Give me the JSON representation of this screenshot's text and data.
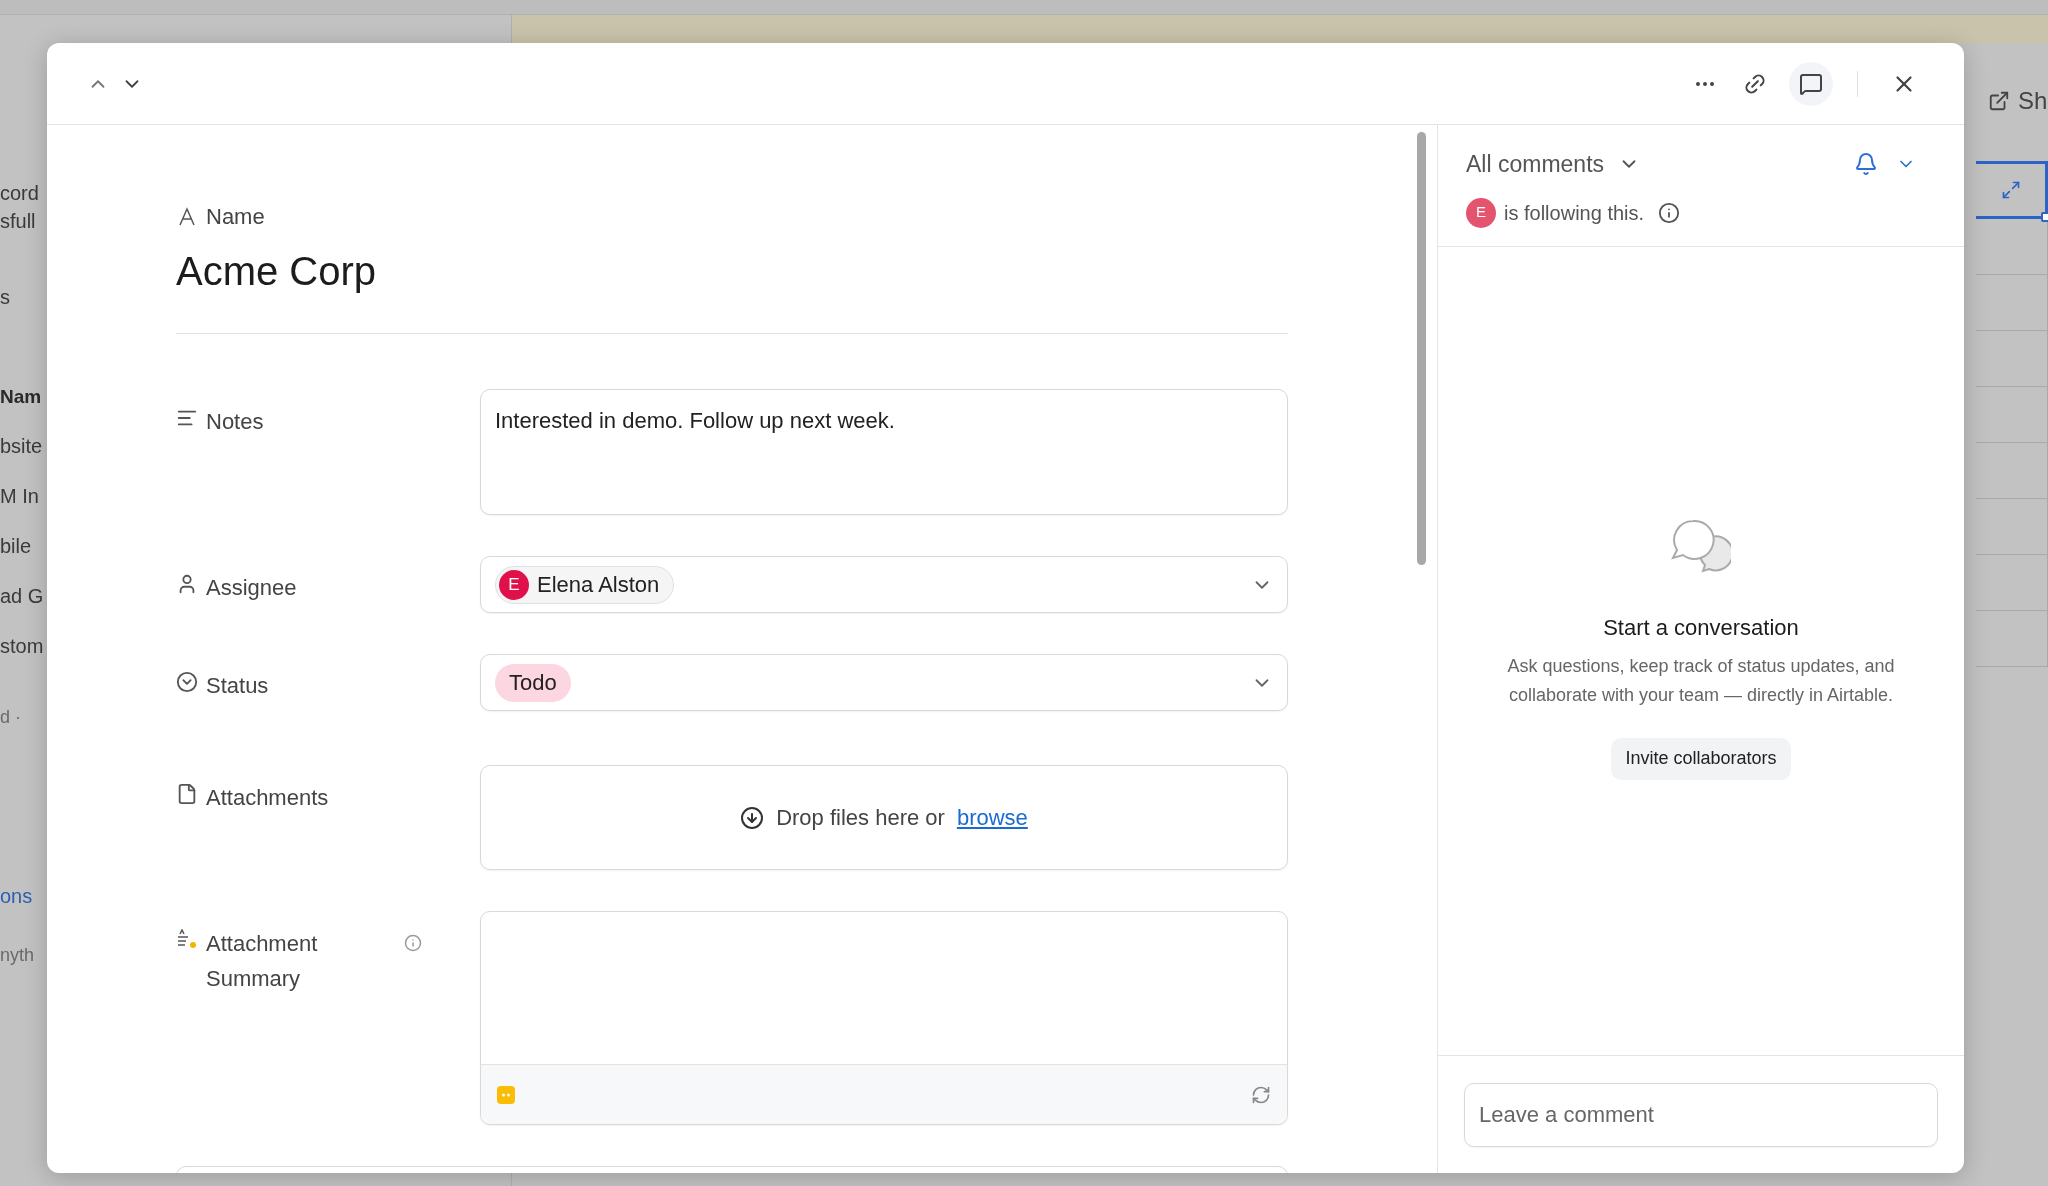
{
  "background": {
    "left_fragments": [
      {
        "text": "cord",
        "kind": "text"
      },
      {
        "text": "sfull",
        "kind": "text"
      },
      {
        "text": "s",
        "kind": "text"
      },
      {
        "text": "Nam",
        "kind": "header"
      },
      {
        "text": "bsite",
        "kind": "text"
      },
      {
        "text": "M In",
        "kind": "text"
      },
      {
        "text": "bile",
        "kind": "text"
      },
      {
        "text": "ad G",
        "kind": "text"
      },
      {
        "text": "stom",
        "kind": "text"
      },
      {
        "text": "d ·",
        "kind": "muted"
      },
      {
        "text": "ons",
        "kind": "link"
      },
      {
        "text": "nyth",
        "kind": "muted"
      }
    ],
    "right_button": "Sh"
  },
  "header": {
    "comments_selected": true
  },
  "record": {
    "name_label": "Name",
    "name": "Acme Corp",
    "fields": [
      {
        "kind": "long_text",
        "label": "Notes",
        "value": "Interested in demo. Follow up next week."
      },
      {
        "kind": "user",
        "label": "Assignee",
        "initial": "E",
        "value": "Elena Alston"
      },
      {
        "kind": "select",
        "label": "Status",
        "value": "Todo"
      },
      {
        "kind": "attachment",
        "label": "Attachments",
        "prompt": "Drop files here or",
        "link": "browse"
      },
      {
        "kind": "ai_text",
        "label": "Attachment Summary"
      }
    ]
  },
  "comments": {
    "filter": "All comments",
    "follower_initial": "E",
    "following_text": "is following this.",
    "empty_title": "Start a conversation",
    "empty_text": "Ask questions, keep track of status updates, and collaborate with your team — directly in Airtable.",
    "invite_button": "Invite collaborators",
    "input_placeholder": "Leave a comment"
  }
}
